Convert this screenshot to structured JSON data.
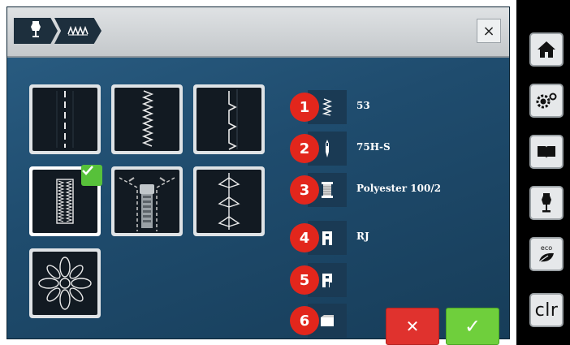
{
  "header": {
    "breadcrumb": [
      {
        "icon": "dress-form-icon"
      },
      {
        "icon": "stitch-pattern-icon"
      }
    ],
    "close_label": "×"
  },
  "stitch_tiles": [
    {
      "name": "straight-seam",
      "icon": "straight-stitch-icon",
      "selected": false
    },
    {
      "name": "zigzag-seam",
      "icon": "zigzag-stitch-icon",
      "selected": false
    },
    {
      "name": "blind-hem",
      "icon": "blind-hem-icon",
      "selected": false
    },
    {
      "name": "buttonhole",
      "icon": "buttonhole-icon",
      "selected": true
    },
    {
      "name": "zipper",
      "icon": "zipper-icon",
      "selected": false
    },
    {
      "name": "decorative-stitch",
      "icon": "decorative-stitch-icon",
      "selected": false
    },
    {
      "name": "embroidery-flower",
      "icon": "flower-icon",
      "selected": false
    }
  ],
  "recommendations": [
    {
      "number": "1",
      "icon": "stitch-icon",
      "text": "53"
    },
    {
      "number": "2",
      "icon": "needle-icon",
      "text": "75H-S"
    },
    {
      "number": "3",
      "icon": "thread-spool-icon",
      "text": "Polyester 100/2"
    },
    {
      "number": "4",
      "icon": "presser-foot-icon",
      "text": "RJ"
    },
    {
      "number": "5",
      "icon": "presser-foot-alt-icon",
      "text": ""
    },
    {
      "number": "6",
      "icon": "stabilizer-icon",
      "text": ""
    }
  ],
  "actions": {
    "cancel": "✕",
    "confirm": "✓"
  },
  "sidebar": [
    {
      "name": "home",
      "icon": "home-icon"
    },
    {
      "name": "settings",
      "icon": "settings-icon"
    },
    {
      "name": "tutorial",
      "icon": "book-icon"
    },
    {
      "name": "sewing-consultant",
      "icon": "dress-form-icon"
    },
    {
      "name": "eco-mode",
      "icon": "eco-leaf-icon",
      "label": "eco"
    },
    {
      "name": "clear",
      "icon": "",
      "label": "clr"
    }
  ],
  "colors": {
    "accent_red": "#e2261c",
    "confirm_green": "#6fcf3c",
    "cancel_red": "#e0322e",
    "screen_blue": "#1f4c6e"
  }
}
